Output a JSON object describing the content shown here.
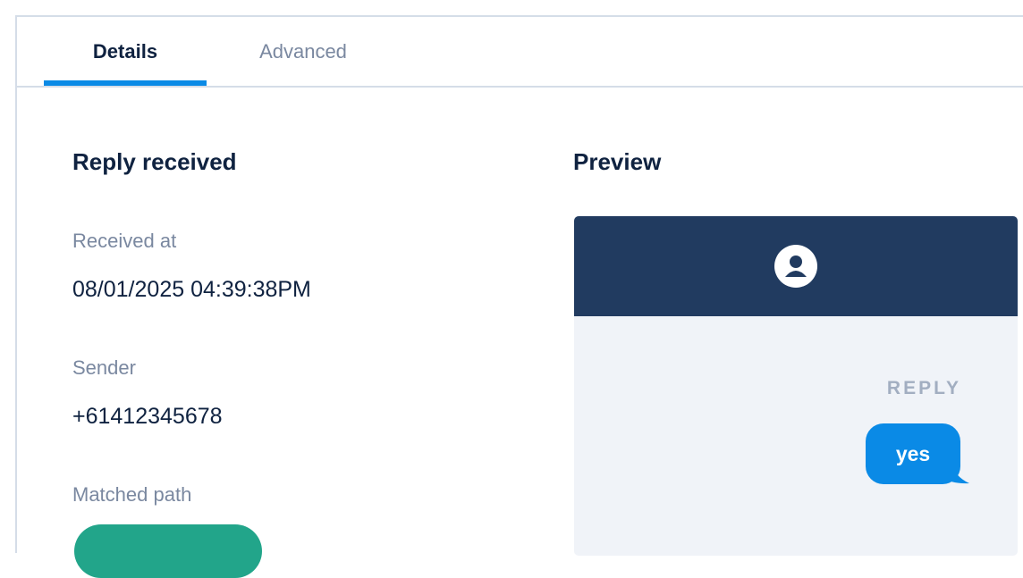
{
  "tabs": [
    {
      "label": "Details",
      "active": true
    },
    {
      "label": "Advanced",
      "active": false
    }
  ],
  "details": {
    "title": "Reply received",
    "fields": [
      {
        "label": "Received at",
        "value": "08/01/2025 04:39:38PM"
      },
      {
        "label": "Sender",
        "value": "+61412345678"
      },
      {
        "label": "Matched path"
      }
    ]
  },
  "preview": {
    "title": "Preview",
    "reply_label": "REPLY",
    "message": "yes",
    "avatar_icon": "user-circle-icon"
  },
  "colors": {
    "accent": "#0a8ae6",
    "header_bg": "#213b60",
    "badge": "#22a58a"
  }
}
